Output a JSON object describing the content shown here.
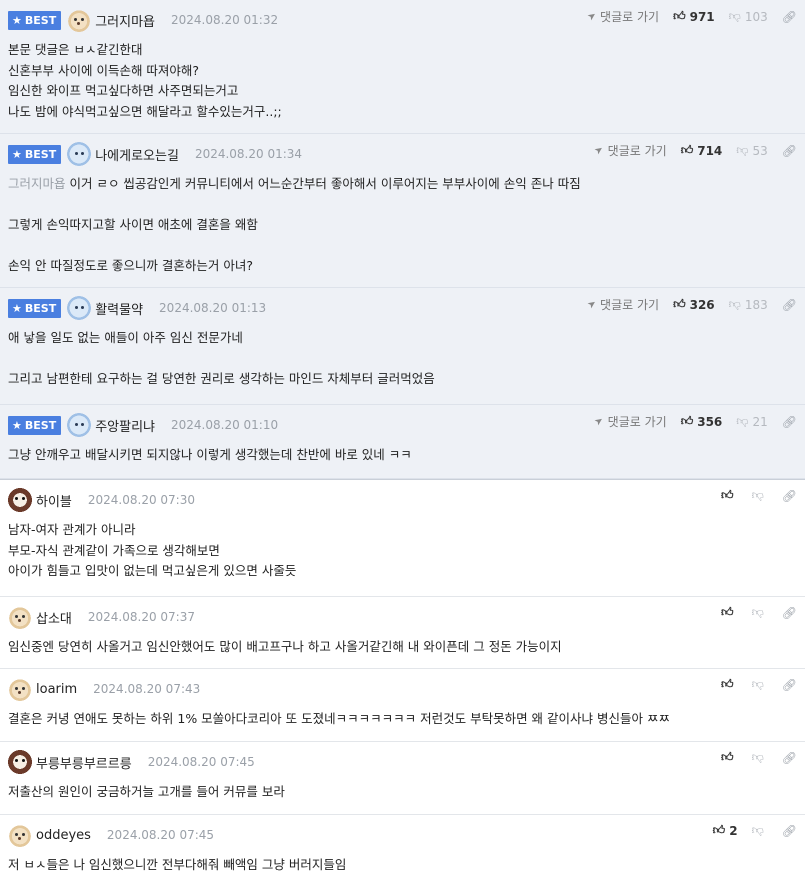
{
  "labels": {
    "best": "BEST",
    "goto": "댓글로 가기"
  },
  "icons": {
    "star": "star-icon",
    "goto": "paper-plane-icon",
    "up": "thumbs-up-icon",
    "down": "thumbs-down-icon",
    "link": "link-icon"
  },
  "comments": [
    {
      "best": true,
      "avatar": "dog",
      "nick": "그러지마욥",
      "time": "2024.08.20 01:32",
      "up": "971",
      "down": "103",
      "mention": "",
      "text": "본문 댓글은 ㅂㅅ같긴한대\n신혼부부 사이에 이득손해 따져야해?\n임신한 와이프 먹고싶다하면 사주면되는거고\n나도 밤에 야식먹고싶으면 해달라고 할수있는거구..;;"
    },
    {
      "best": true,
      "avatar": "cat",
      "nick": "나에게로오는길",
      "time": "2024.08.20 01:34",
      "up": "714",
      "down": "53",
      "mention": "그러지마욥",
      "text": " 이거 ㄹㅇ 씹공감인게 커뮤니티에서 어느순간부터 좋아해서 이루어지는 부부사이에 손익 존나 따짐\n\n그렇게 손익따지고할 사이면 애초에 결혼을 왜함\n\n손익 안 따질정도로 좋으니까 결혼하는거 아녀?"
    },
    {
      "best": true,
      "avatar": "cat",
      "nick": "활력물약",
      "time": "2024.08.20 01:13",
      "up": "326",
      "down": "183",
      "mention": "",
      "text": "애 낳을 일도 없는 애들이 아주 임신 전문가네\n\n그리고 남편한테 요구하는 걸 당연한 권리로 생각하는 마인드 자체부터 글러먹었음"
    },
    {
      "best": true,
      "avatar": "cat",
      "nick": "주앙팔리냐",
      "time": "2024.08.20 01:10",
      "up": "356",
      "down": "21",
      "mention": "",
      "text": "그냥 안깨우고 배달시키면 되지않나 이렇게 생각했는데 찬반에 바로 있네 ㅋㅋ"
    },
    {
      "best": false,
      "avatar": "mask",
      "nick": "하이블",
      "time": "2024.08.20 07:30",
      "up": "",
      "down": "",
      "mention": "",
      "text": "남자-여자 관계가 아니라\n부모-자식 관계같이 가족으로 생각해보면\n아이가 힘들고 입맛이 없는데 먹고싶은게 있으면 사줄듯"
    },
    {
      "best": false,
      "avatar": "dog",
      "nick": "삽소대",
      "time": "2024.08.20 07:37",
      "up": "",
      "down": "",
      "mention": "",
      "text": "임신중엔 당연히 사올거고 임신안했어도 많이 배고프구나 하고 사올거같긴해 내 와이픈데 그 정돈 가능이지"
    },
    {
      "best": false,
      "avatar": "dog",
      "nick": "loarim",
      "time": "2024.08.20 07:43",
      "up": "",
      "down": "",
      "mention": "",
      "text": "결혼은 커녕 연애도 못하는 하위 1% 모쏠아다코리아 또 도졌네ㅋㅋㅋㅋㅋㅋㅋ 저런것도 부탁못하면 왜 같이사냐 병신들아 ㅉㅉ"
    },
    {
      "best": false,
      "avatar": "mask",
      "nick": "부릉부릉부르르릉",
      "time": "2024.08.20 07:45",
      "up": "",
      "down": "",
      "mention": "",
      "text": "저출산의 원인이 궁금하거늘 고개를 들어 커뮤를 보라"
    },
    {
      "best": false,
      "avatar": "dog",
      "nick": "oddeyes",
      "time": "2024.08.20 07:45",
      "up": "2",
      "down": "",
      "mention": "",
      "text": "저 ㅂㅅ들은 나 임신했으니깐 전부다해줘 빼액임 그냥 버러지들임"
    }
  ]
}
